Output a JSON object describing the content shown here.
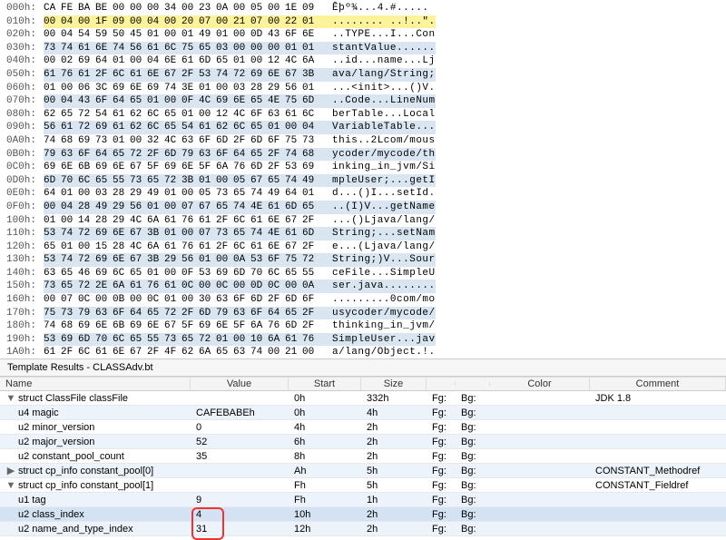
{
  "hex": {
    "rows": [
      {
        "off": "000h:",
        "bytes": [
          "CA",
          "FE",
          "BA",
          "BE",
          "00",
          "00",
          "00",
          "34",
          "00",
          "23",
          "0A",
          "00",
          "05",
          "00",
          "1E",
          "09"
        ],
        "ascii": "Êþº¾...4.#.....",
        "hl": "none"
      },
      {
        "off": "010h:",
        "bytes": [
          "00",
          "04",
          "00",
          "1F",
          "09",
          "00",
          "04",
          "00",
          "20",
          "07",
          "00",
          "21",
          "07",
          "00",
          "22",
          "01"
        ],
        "ascii": "........ ..!..\".",
        "hl": "yellow"
      },
      {
        "off": "020h:",
        "bytes": [
          "00",
          "04",
          "54",
          "59",
          "50",
          "45",
          "01",
          "00",
          "01",
          "49",
          "01",
          "00",
          "0D",
          "43",
          "6F",
          "6E"
        ],
        "ascii": "..TYPE...I...Con",
        "hl": "none"
      },
      {
        "off": "030h:",
        "bytes": [
          "73",
          "74",
          "61",
          "6E",
          "74",
          "56",
          "61",
          "6C",
          "75",
          "65",
          "03",
          "00",
          "00",
          "00",
          "01",
          "01"
        ],
        "ascii": "stantValue......",
        "hl": "blue"
      },
      {
        "off": "040h:",
        "bytes": [
          "00",
          "02",
          "69",
          "64",
          "01",
          "00",
          "04",
          "6E",
          "61",
          "6D",
          "65",
          "01",
          "00",
          "12",
          "4C",
          "6A"
        ],
        "ascii": "..id...name...Lj",
        "hl": "none"
      },
      {
        "off": "050h:",
        "bytes": [
          "61",
          "76",
          "61",
          "2F",
          "6C",
          "61",
          "6E",
          "67",
          "2F",
          "53",
          "74",
          "72",
          "69",
          "6E",
          "67",
          "3B"
        ],
        "ascii": "ava/lang/String;",
        "hl": "blue"
      },
      {
        "off": "060h:",
        "bytes": [
          "01",
          "00",
          "06",
          "3C",
          "69",
          "6E",
          "69",
          "74",
          "3E",
          "01",
          "00",
          "03",
          "28",
          "29",
          "56",
          "01"
        ],
        "ascii": "...<init>...()V.",
        "hl": "none"
      },
      {
        "off": "070h:",
        "bytes": [
          "00",
          "04",
          "43",
          "6F",
          "64",
          "65",
          "01",
          "00",
          "0F",
          "4C",
          "69",
          "6E",
          "65",
          "4E",
          "75",
          "6D"
        ],
        "ascii": "..Code...LineNum",
        "hl": "blue"
      },
      {
        "off": "080h:",
        "bytes": [
          "62",
          "65",
          "72",
          "54",
          "61",
          "62",
          "6C",
          "65",
          "01",
          "00",
          "12",
          "4C",
          "6F",
          "63",
          "61",
          "6C"
        ],
        "ascii": "berTable...Local",
        "hl": "none"
      },
      {
        "off": "090h:",
        "bytes": [
          "56",
          "61",
          "72",
          "69",
          "61",
          "62",
          "6C",
          "65",
          "54",
          "61",
          "62",
          "6C",
          "65",
          "01",
          "00",
          "04"
        ],
        "ascii": "VariableTable...",
        "hl": "blue"
      },
      {
        "off": "0A0h:",
        "bytes": [
          "74",
          "68",
          "69",
          "73",
          "01",
          "00",
          "32",
          "4C",
          "63",
          "6F",
          "6D",
          "2F",
          "6D",
          "6F",
          "75",
          "73"
        ],
        "ascii": "this..2Lcom/mous",
        "hl": "none"
      },
      {
        "off": "0B0h:",
        "bytes": [
          "79",
          "63",
          "6F",
          "64",
          "65",
          "72",
          "2F",
          "6D",
          "79",
          "63",
          "6F",
          "64",
          "65",
          "2F",
          "74",
          "68"
        ],
        "ascii": "ycoder/mycode/th",
        "hl": "blue"
      },
      {
        "off": "0C0h:",
        "bytes": [
          "69",
          "6E",
          "6B",
          "69",
          "6E",
          "67",
          "5F",
          "69",
          "6E",
          "5F",
          "6A",
          "76",
          "6D",
          "2F",
          "53",
          "69"
        ],
        "ascii": "inking_in_jvm/Si",
        "hl": "none"
      },
      {
        "off": "0D0h:",
        "bytes": [
          "6D",
          "70",
          "6C",
          "65",
          "55",
          "73",
          "65",
          "72",
          "3B",
          "01",
          "00",
          "05",
          "67",
          "65",
          "74",
          "49"
        ],
        "ascii": "mpleUser;...getI",
        "hl": "blue"
      },
      {
        "off": "0E0h:",
        "bytes": [
          "64",
          "01",
          "00",
          "03",
          "28",
          "29",
          "49",
          "01",
          "00",
          "05",
          "73",
          "65",
          "74",
          "49",
          "64",
          "01"
        ],
        "ascii": "d...()I...setId.",
        "hl": "none"
      },
      {
        "off": "0F0h:",
        "bytes": [
          "00",
          "04",
          "28",
          "49",
          "29",
          "56",
          "01",
          "00",
          "07",
          "67",
          "65",
          "74",
          "4E",
          "61",
          "6D",
          "65"
        ],
        "ascii": "..(I)V...getName",
        "hl": "blue"
      },
      {
        "off": "100h:",
        "bytes": [
          "01",
          "00",
          "14",
          "28",
          "29",
          "4C",
          "6A",
          "61",
          "76",
          "61",
          "2F",
          "6C",
          "61",
          "6E",
          "67",
          "2F"
        ],
        "ascii": "...()Ljava/lang/",
        "hl": "none"
      },
      {
        "off": "110h:",
        "bytes": [
          "53",
          "74",
          "72",
          "69",
          "6E",
          "67",
          "3B",
          "01",
          "00",
          "07",
          "73",
          "65",
          "74",
          "4E",
          "61",
          "6D"
        ],
        "ascii": "String;...setNam",
        "hl": "blue"
      },
      {
        "off": "120h:",
        "bytes": [
          "65",
          "01",
          "00",
          "15",
          "28",
          "4C",
          "6A",
          "61",
          "76",
          "61",
          "2F",
          "6C",
          "61",
          "6E",
          "67",
          "2F"
        ],
        "ascii": "e...(Ljava/lang/",
        "hl": "none"
      },
      {
        "off": "130h:",
        "bytes": [
          "53",
          "74",
          "72",
          "69",
          "6E",
          "67",
          "3B",
          "29",
          "56",
          "01",
          "00",
          "0A",
          "53",
          "6F",
          "75",
          "72"
        ],
        "ascii": "String;)V...Sour",
        "hl": "blue"
      },
      {
        "off": "140h:",
        "bytes": [
          "63",
          "65",
          "46",
          "69",
          "6C",
          "65",
          "01",
          "00",
          "0F",
          "53",
          "69",
          "6D",
          "70",
          "6C",
          "65",
          "55"
        ],
        "ascii": "ceFile...SimpleU",
        "hl": "none"
      },
      {
        "off": "150h:",
        "bytes": [
          "73",
          "65",
          "72",
          "2E",
          "6A",
          "61",
          "76",
          "61",
          "0C",
          "00",
          "0C",
          "00",
          "0D",
          "0C",
          "00",
          "0A"
        ],
        "ascii": "ser.java........",
        "hl": "blue"
      },
      {
        "off": "160h:",
        "bytes": [
          "00",
          "07",
          "0C",
          "00",
          "0B",
          "00",
          "0C",
          "01",
          "00",
          "30",
          "63",
          "6F",
          "6D",
          "2F",
          "6D",
          "6F"
        ],
        "ascii": ".........0com/mo",
        "hl": "none"
      },
      {
        "off": "170h:",
        "bytes": [
          "75",
          "73",
          "79",
          "63",
          "6F",
          "64",
          "65",
          "72",
          "2F",
          "6D",
          "79",
          "63",
          "6F",
          "64",
          "65",
          "2F"
        ],
        "ascii": "usycoder/mycode/",
        "hl": "blue"
      },
      {
        "off": "180h:",
        "bytes": [
          "74",
          "68",
          "69",
          "6E",
          "6B",
          "69",
          "6E",
          "67",
          "5F",
          "69",
          "6E",
          "5F",
          "6A",
          "76",
          "6D",
          "2F"
        ],
        "ascii": "thinking_in_jvm/",
        "hl": "none"
      },
      {
        "off": "190h:",
        "bytes": [
          "53",
          "69",
          "6D",
          "70",
          "6C",
          "65",
          "55",
          "73",
          "65",
          "72",
          "01",
          "00",
          "10",
          "6A",
          "61",
          "76"
        ],
        "ascii": "SimpleUser...jav",
        "hl": "blue"
      },
      {
        "off": "1A0h:",
        "bytes": [
          "61",
          "2F",
          "6C",
          "61",
          "6E",
          "67",
          "2F",
          "4F",
          "62",
          "6A",
          "65",
          "63",
          "74",
          "00",
          "21",
          "00"
        ],
        "ascii": "a/lang/Object.!.",
        "hl": "none"
      }
    ]
  },
  "template": {
    "title": "Template Results - CLASSAdv.bt",
    "headers": {
      "name": "Name",
      "value": "Value",
      "start": "Start",
      "size": "Size",
      "color": "Color",
      "comment": "Comment"
    },
    "rows": [
      {
        "disclose": "▼",
        "indent": 0,
        "name": "struct ClassFile classFile",
        "value": "",
        "start": "0h",
        "size": "332h",
        "fg": "Fg:",
        "bg": "Bg:",
        "color": "",
        "comment": "JDK 1.8",
        "alt": false,
        "sel": false
      },
      {
        "disclose": "",
        "indent": 1,
        "name": "u4 magic",
        "value": "CAFEBABEh",
        "start": "0h",
        "size": "4h",
        "fg": "Fg:",
        "bg": "Bg:",
        "color": "",
        "comment": "",
        "alt": true,
        "sel": false
      },
      {
        "disclose": "",
        "indent": 1,
        "name": "u2 minor_version",
        "value": "0",
        "start": "4h",
        "size": "2h",
        "fg": "Fg:",
        "bg": "Bg:",
        "color": "",
        "comment": "",
        "alt": false,
        "sel": false
      },
      {
        "disclose": "",
        "indent": 1,
        "name": "u2 major_version",
        "value": "52",
        "start": "6h",
        "size": "2h",
        "fg": "Fg:",
        "bg": "Bg:",
        "color": "",
        "comment": "",
        "alt": true,
        "sel": false
      },
      {
        "disclose": "",
        "indent": 1,
        "name": "u2 constant_pool_count",
        "value": "35",
        "start": "8h",
        "size": "2h",
        "fg": "Fg:",
        "bg": "Bg:",
        "color": "",
        "comment": "",
        "alt": false,
        "sel": false
      },
      {
        "disclose": "▶",
        "indent": 1,
        "name": "struct cp_info constant_pool[0]",
        "value": "",
        "start": "Ah",
        "size": "5h",
        "fg": "Fg:",
        "bg": "Bg:",
        "color": "",
        "comment": "CONSTANT_Methodref",
        "alt": true,
        "sel": false
      },
      {
        "disclose": "▼",
        "indent": 1,
        "name": "struct cp_info constant_pool[1]",
        "value": "",
        "start": "Fh",
        "size": "5h",
        "fg": "Fg:",
        "bg": "Bg:",
        "color": "",
        "comment": "CONSTANT_Fieldref",
        "alt": false,
        "sel": false
      },
      {
        "disclose": "",
        "indent": 2,
        "name": "u1 tag",
        "value": "9",
        "start": "Fh",
        "size": "1h",
        "fg": "Fg:",
        "bg": "Bg:",
        "color": "",
        "comment": "",
        "alt": true,
        "sel": false
      },
      {
        "disclose": "",
        "indent": 2,
        "name": "u2 class_index",
        "value": "4",
        "start": "10h",
        "size": "2h",
        "fg": "Fg:",
        "bg": "Bg:",
        "color": "",
        "comment": "",
        "alt": false,
        "sel": true,
        "redbox": true
      },
      {
        "disclose": "",
        "indent": 2,
        "name": "u2 name_and_type_index",
        "value": "31",
        "start": "12h",
        "size": "2h",
        "fg": "Fg:",
        "bg": "Bg:",
        "color": "",
        "comment": "",
        "alt": true,
        "sel": false
      }
    ]
  }
}
